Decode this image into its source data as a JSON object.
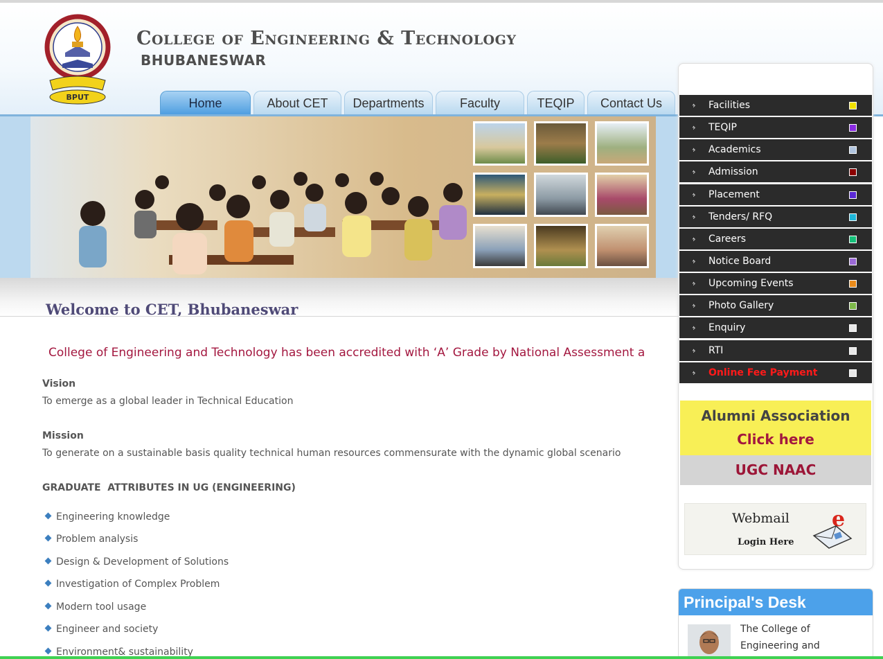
{
  "header": {
    "title": "College of Engineering & Technology",
    "subtitle": "BHUBANESWAR",
    "logo_text": "BPUT"
  },
  "nav": {
    "tabs": [
      {
        "label": "Home",
        "active": true
      },
      {
        "label": "About CET",
        "active": false
      },
      {
        "label": "Departments",
        "active": false
      },
      {
        "label": "Faculty",
        "active": false
      },
      {
        "label": "TEQIP",
        "active": false
      },
      {
        "label": "Contact Us",
        "active": false
      }
    ]
  },
  "main": {
    "welcome": "Welcome to CET, Bhubaneswar",
    "marquee": "College of Engineering and Technology has been accredited with ‘A’ Grade by National Assessment a",
    "vision_heading": "Vision",
    "vision_text": "To emerge as a global leader in Technical Education",
    "mission_heading": "Mission",
    "mission_text": "To generate on a sustainable basis quality technical human resources commensurate with the dynamic global scenario",
    "attributes_heading": "GRADUATE  ATTRIBUTES IN UG (ENGINEERING)",
    "attributes": [
      "Engineering knowledge",
      "Problem analysis",
      "Design & Development of Solutions",
      "Investigation of Complex Problem",
      "Modern tool usage",
      "Engineer and society",
      "Environment& sustainability"
    ]
  },
  "sidebar": {
    "menu": [
      {
        "label": "Facilities",
        "color": "#f0e000"
      },
      {
        "label": "TEQIP",
        "color": "#8a2be2"
      },
      {
        "label": "Academics",
        "color": "#b0c4de"
      },
      {
        "label": "Admission",
        "color": "#8b0000"
      },
      {
        "label": "Placement",
        "color": "#5b2ad6"
      },
      {
        "label": "Tenders/ RFQ",
        "color": "#1fb6d9"
      },
      {
        "label": "Careers",
        "color": "#16c07a"
      },
      {
        "label": "Notice Board",
        "color": "#9b6ad6"
      },
      {
        "label": "Upcoming Events",
        "color": "#e88a1a"
      },
      {
        "label": "Photo Gallery",
        "color": "#7db84a"
      },
      {
        "label": "Enquiry",
        "color": "#e8e8e8"
      },
      {
        "label": "RTI",
        "color": "#e8e8e8"
      },
      {
        "label": "Online Fee Payment",
        "color": "#e8e8e8"
      }
    ],
    "alumni_line1": "Alumni Association",
    "alumni_line2": "Click here",
    "ugc": "UGC NAAC",
    "webmail_title": "Webmail",
    "webmail_sub": "Login Here",
    "principal_title": "Principal's Desk",
    "principal_text_1": "The College of",
    "principal_text_2": "Engineering and"
  }
}
